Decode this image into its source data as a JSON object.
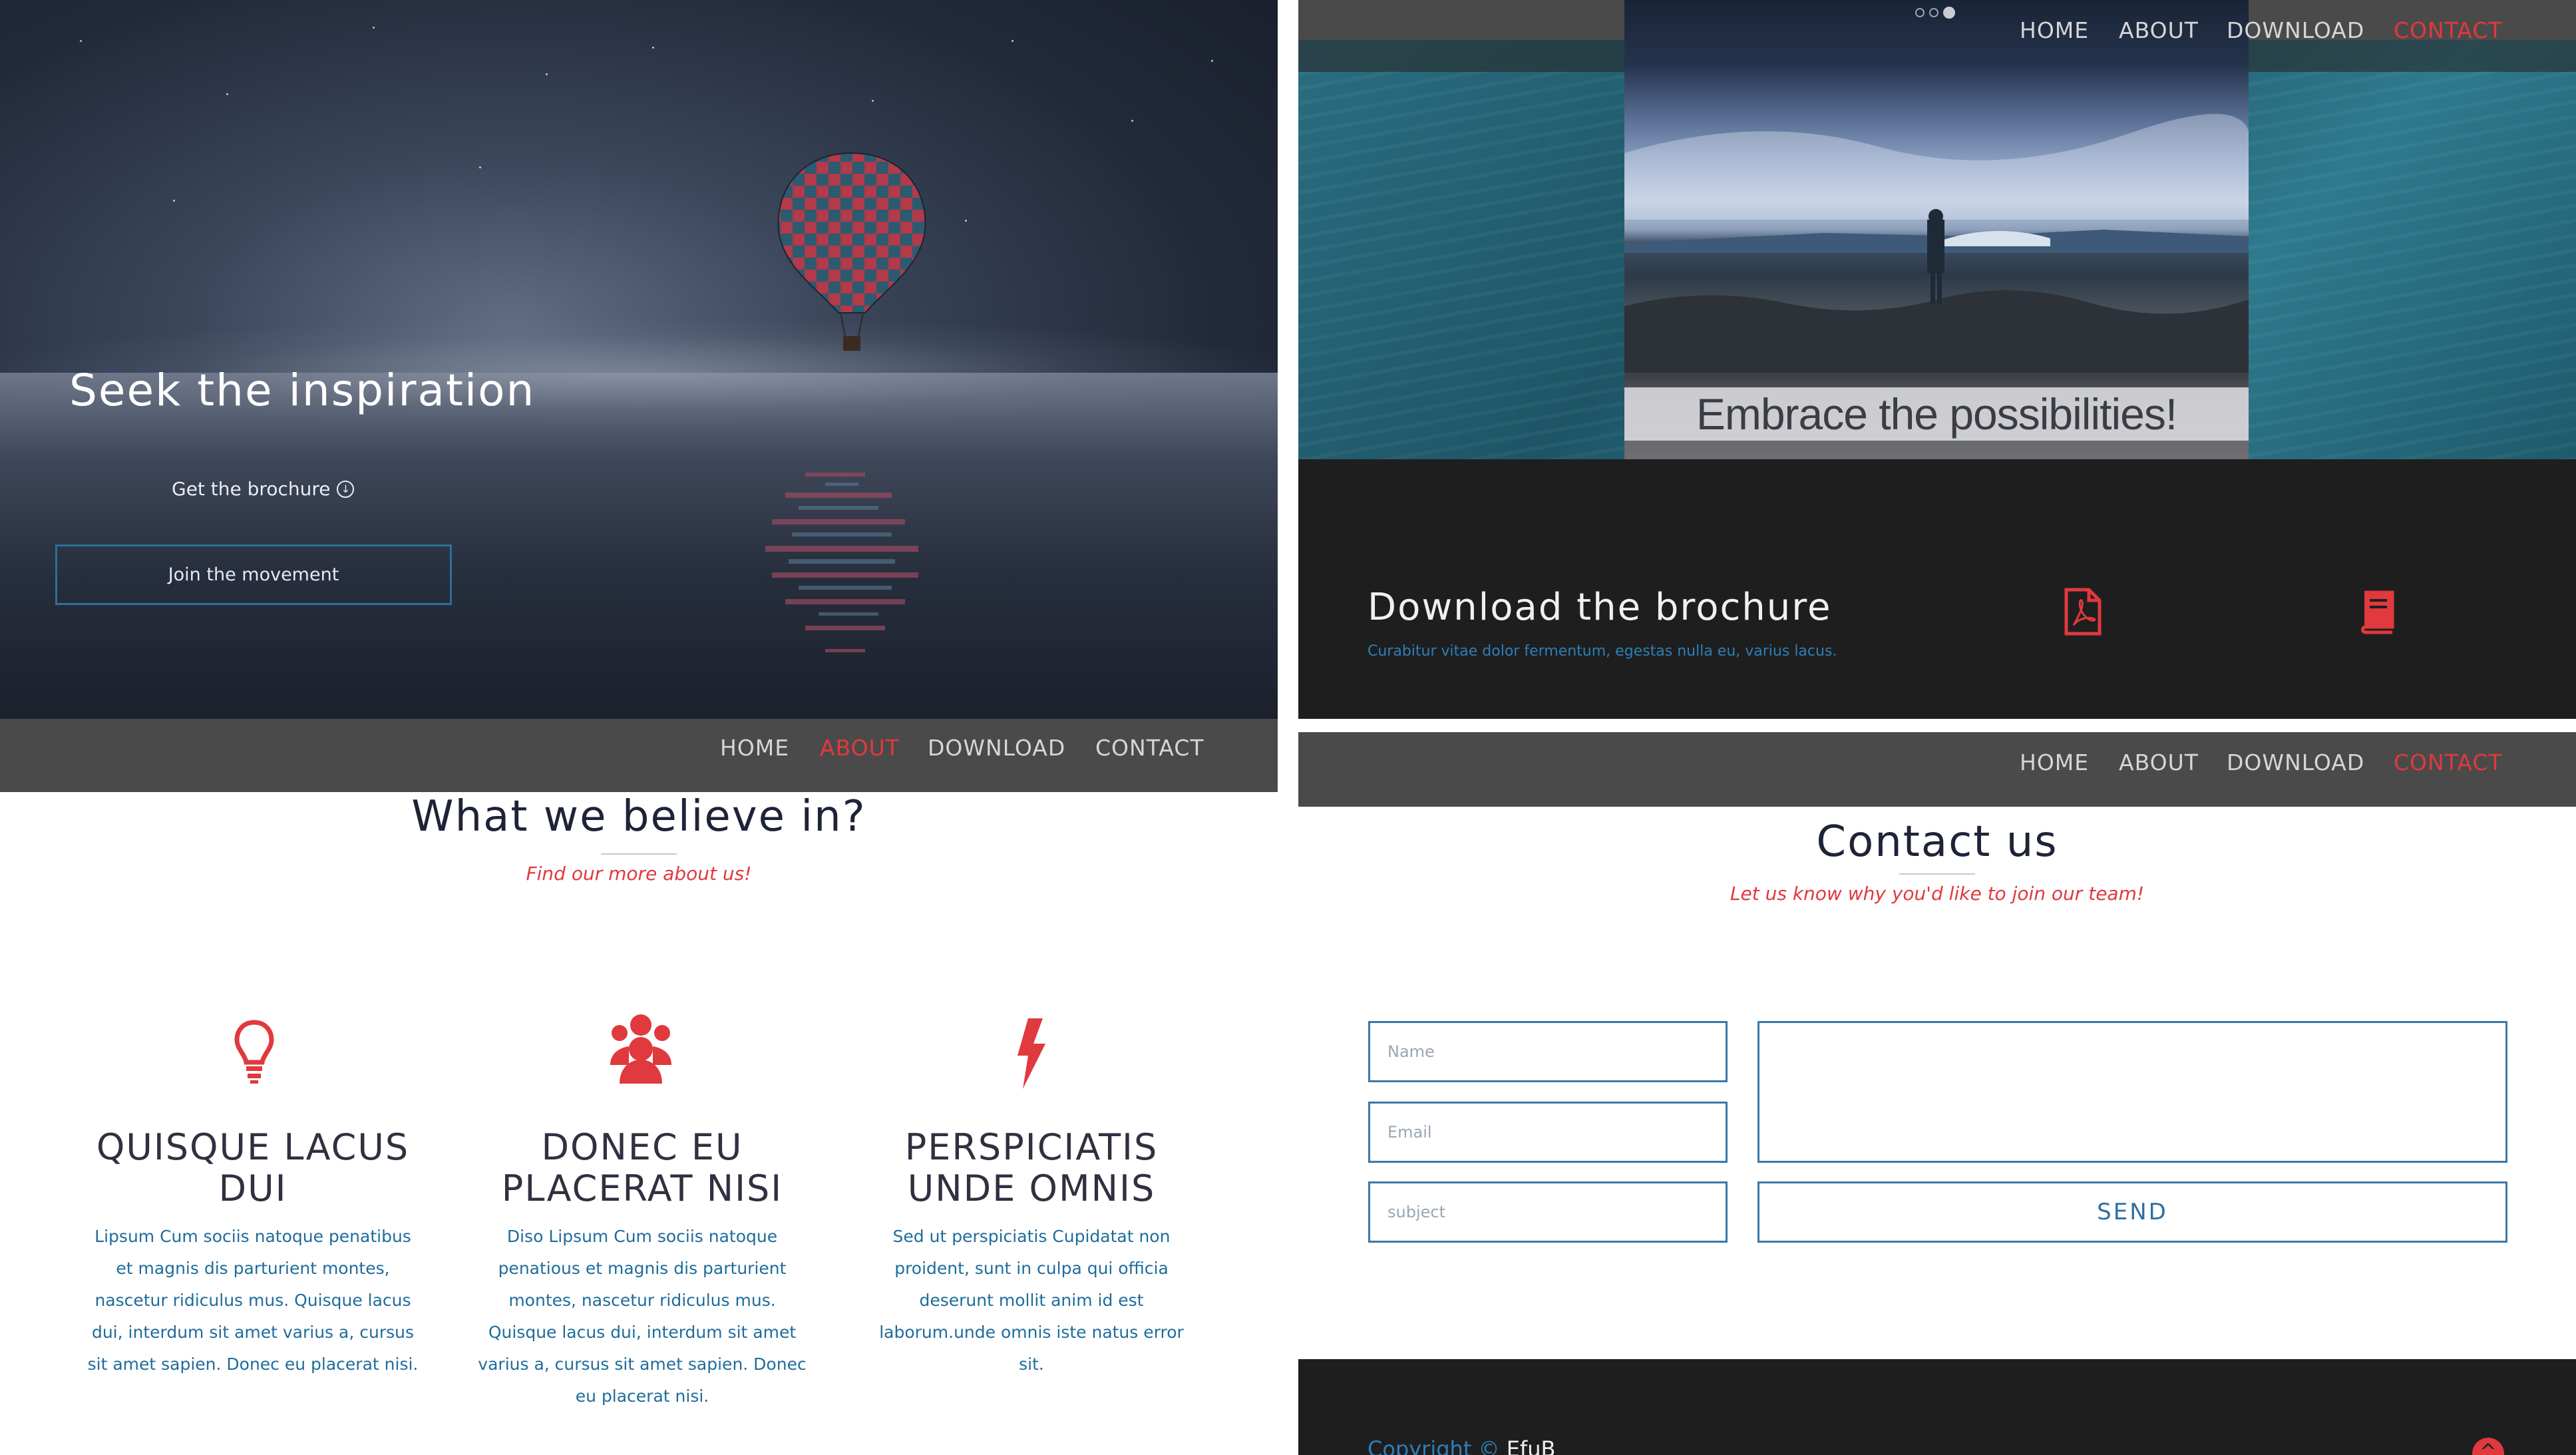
{
  "hero": {
    "title": "Seek the inspiration",
    "brochure_link": "Get the brochure",
    "cta_button": "Join the movement"
  },
  "nav": {
    "items": [
      "HOME",
      "ABOUT",
      "DOWNLOAD",
      "CONTACT"
    ]
  },
  "about": {
    "title": "What we believe in?",
    "subtitle": "Find our more about us!",
    "features": [
      {
        "icon": "lightbulb-icon",
        "title": "QUISQUE LACUS DUI",
        "text": "Lipsum Cum sociis natoque penatibus et magnis dis parturient montes, nascetur ridiculus mus. Quisque lacus dui, interdum sit amet varius a, cursus sit amet sapien. Donec eu placerat nisi."
      },
      {
        "icon": "users-icon",
        "title": "DONEC EU PLACERAT NISI",
        "text": "Diso Lipsum Cum sociis natoque penatious et magnis dis parturient montes, nascetur ridiculus mus. Quisque lacus dui, interdum sit amet varius a, cursus sit amet sapien. Donec eu placerat nisi."
      },
      {
        "icon": "bolt-icon",
        "title": "PERSPICIATIS UNDE OMNIS",
        "text": "Sed ut perspiciatis Cupidatat non proident, sunt in culpa qui officia deserunt mollit anim id est laborum.unde omnis iste natus error sit."
      }
    ]
  },
  "gallery": {
    "caption": "Embrace the possibilities!"
  },
  "download": {
    "title": "Download the brochure",
    "subtitle": "Curabitur vitae dolor fermentum, egestas nulla eu, varius lacus.",
    "icons": [
      "pdf-icon",
      "book-icon"
    ]
  },
  "contact": {
    "title": "Contact us",
    "subtitle": "Let us know why you'd like to join our team!",
    "name_placeholder": "Name",
    "email_placeholder": "Email",
    "subject_placeholder": "subject",
    "send_label": "SEND"
  },
  "footer": {
    "copyright_label": "Copyright ©",
    "brand": "EfuB"
  },
  "colors": {
    "accent": "#e0393e",
    "link_blue": "#1f6c9b",
    "nav_bar": "#4a4a4a",
    "dark_section": "#1e1e1f"
  }
}
